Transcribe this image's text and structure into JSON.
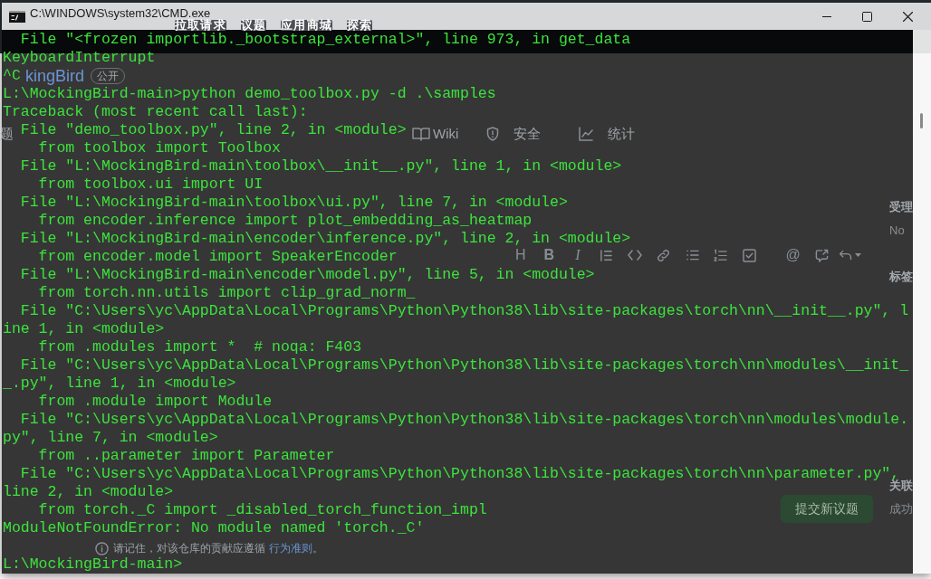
{
  "window": {
    "title": "C:\\WINDOWS\\system32\\CMD.exe"
  },
  "console": {
    "blocks": [
      [
        "  File \"<frozen importlib._bootstrap_external>\", line 973, in get_data",
        "KeyboardInterrupt",
        "^C",
        "L:\\MockingBird-main>python demo_toolbox.py -d .\\samples",
        "Traceback (most recent call last):",
        "  File \"demo_toolbox.py\", line 2, in <module>",
        "    from toolbox import Toolbox",
        "  File \"L:\\MockingBird-main\\toolbox\\__init__.py\", line 1, in <module>",
        "    from toolbox.ui import UI",
        "  File \"L:\\MockingBird-main\\toolbox\\ui.py\", line 7, in <module>",
        "    from encoder.inference import plot_embedding_as_heatmap",
        "  File \"L:\\MockingBird-main\\encoder\\inference.py\", line 2, in <module>",
        "    from encoder.model import SpeakerEncoder",
        "  File \"L:\\MockingBird-main\\encoder\\model.py\", line 5, in <module>",
        "    from torch.nn.utils import clip_grad_norm_",
        "  File \"C:\\Users\\yc\\AppData\\Local\\Programs\\Python\\Python38\\lib\\site-packages\\torch\\nn\\__init__.py\", l",
        "ine 1, in <module>",
        "    from .modules import *  # noqa: F403",
        "  File \"C:\\Users\\yc\\AppData\\Local\\Programs\\Python\\Python38\\lib\\site-packages\\torch\\nn\\modules\\__init_",
        "_.py\", line 1, in <module>",
        "    from .module import Module",
        "  File \"C:\\Users\\yc\\AppData\\Local\\Programs\\Python\\Python38\\lib\\site-packages\\torch\\nn\\modules\\module.",
        "py\", line 7, in <module>",
        "    from ..parameter import Parameter",
        "  File \"C:\\Users\\yc\\AppData\\Local\\Programs\\Python\\Python38\\lib\\site-packages\\torch\\nn\\parameter.py\",",
        "line 2, in <module>",
        "    from torch._C import _disabled_torch_function_impl",
        "ModuleNotFoundError: No module named 'torch._C'"
      ],
      [
        "L:\\MockingBird-main>"
      ]
    ]
  },
  "background_page": {
    "nav": [
      "拉取请求",
      "议题",
      "应用商城",
      "探索"
    ],
    "repo_name": "kingBird",
    "visibility_badge": "公开",
    "tabs": [
      {
        "label": "题"
      },
      {
        "label": "Wiki"
      },
      {
        "label": "安全"
      },
      {
        "label": "统计"
      }
    ],
    "editor_toolbar": [
      "H",
      "B",
      "I",
      "@"
    ],
    "submit_button": "提交新议题",
    "sidebar": [
      {
        "kind": "heading",
        "text": "受理"
      },
      {
        "kind": "value",
        "text": "No"
      },
      {
        "kind": "heading",
        "text": "标签"
      },
      {
        "kind": "heading",
        "text": "关联"
      },
      {
        "kind": "value",
        "text": "成功"
      }
    ],
    "note": {
      "text": "请记住，对该仓库的贡献应遵循",
      "link": "行为准则",
      "end": "。"
    }
  }
}
